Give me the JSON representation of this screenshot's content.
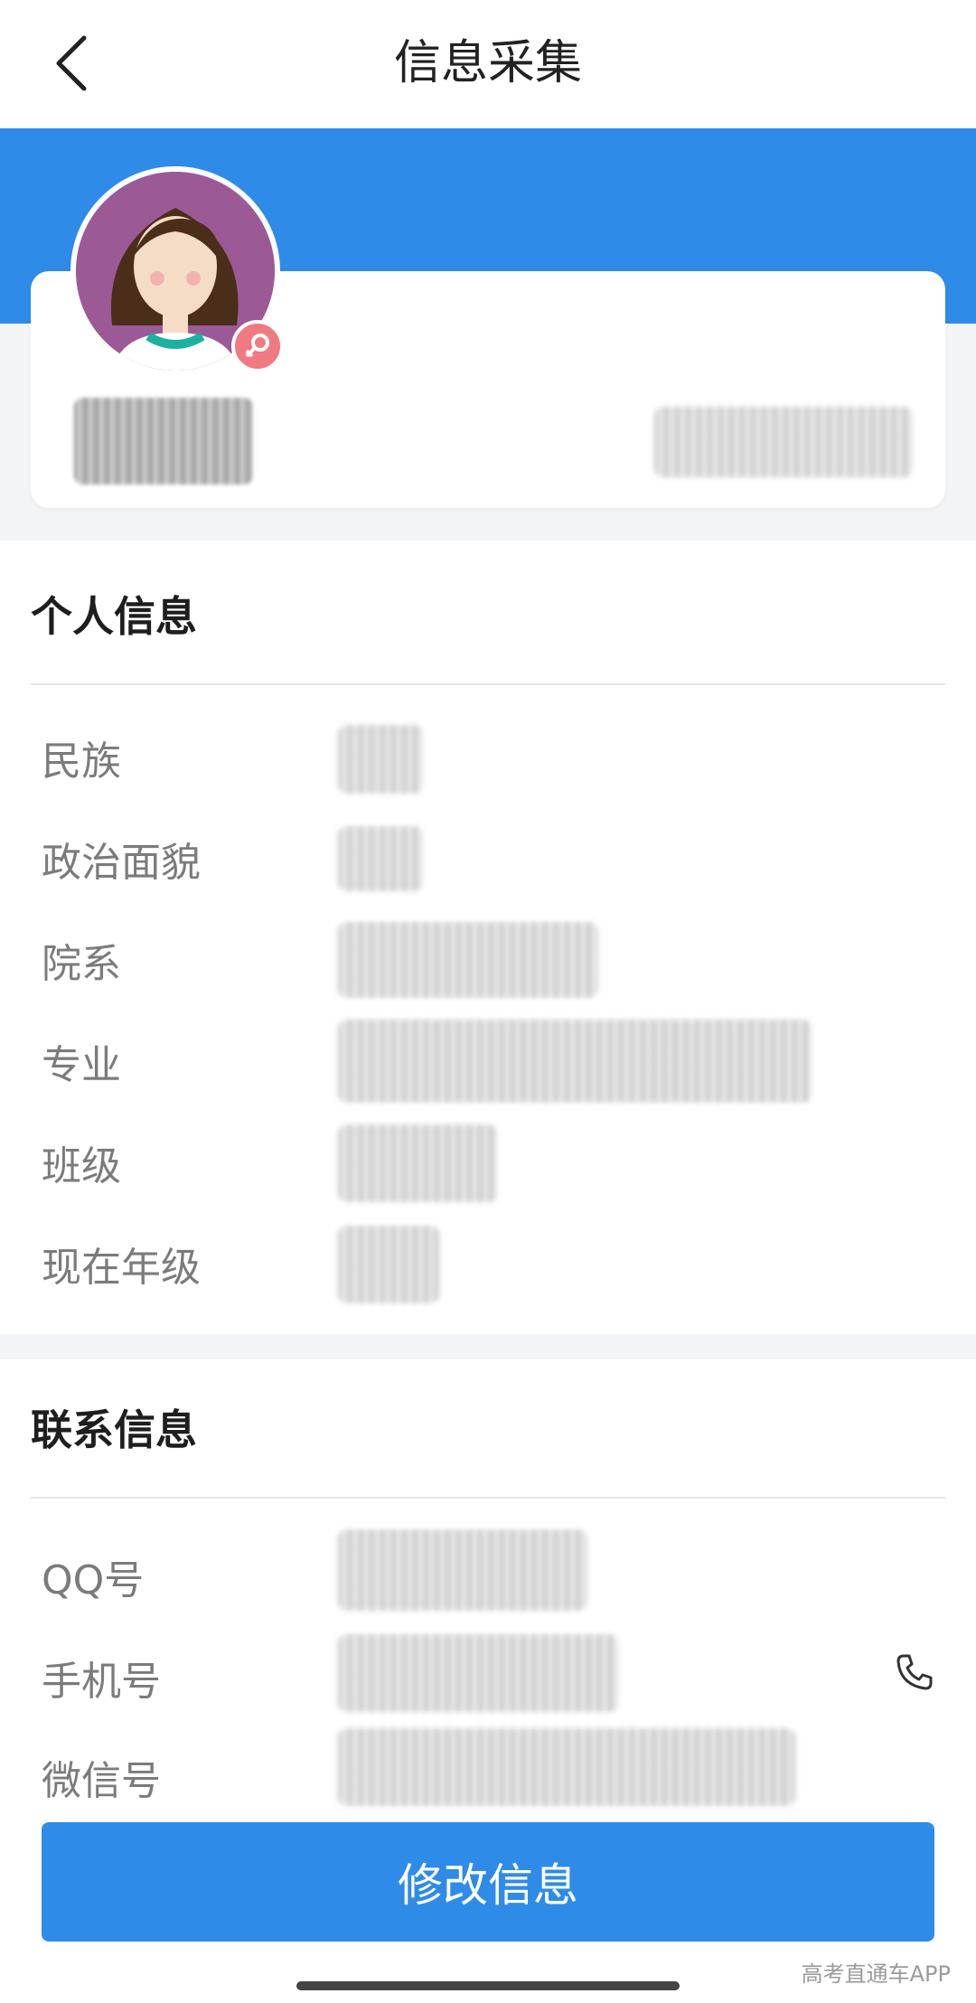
{
  "header": {
    "title": "信息采集"
  },
  "sections": {
    "personal": {
      "title": "个人信息",
      "rows": [
        {
          "label": "民族"
        },
        {
          "label": "政治面貌"
        },
        {
          "label": "院系"
        },
        {
          "label": "专业"
        },
        {
          "label": "班级"
        },
        {
          "label": "现在年级"
        }
      ]
    },
    "contact": {
      "title": "联系信息",
      "rows": [
        {
          "label": "QQ号"
        },
        {
          "label": "手机号"
        },
        {
          "label": "微信号"
        }
      ]
    }
  },
  "button": {
    "label": "修改信息"
  },
  "watermark": "高考直通车APP",
  "colors": {
    "accent": "#2f8be8",
    "badge": "#f07a82",
    "avatar_bg": "#9b5a96"
  },
  "icons": {
    "back": "chevron-left-icon",
    "gender": "female-icon",
    "phone": "phone-icon"
  }
}
